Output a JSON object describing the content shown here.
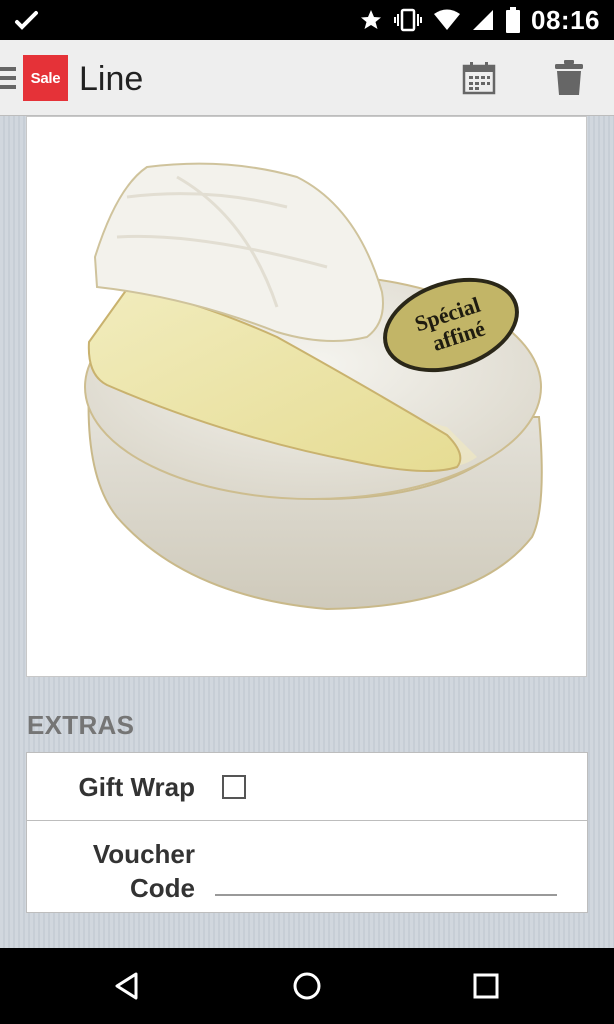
{
  "status_bar": {
    "time": "08:16",
    "icons": [
      "edit-check-icon",
      "star-icon",
      "vibrate-icon",
      "wifi-icon",
      "signal-icon",
      "battery-icon"
    ]
  },
  "app_bar": {
    "logo_text": "Sale",
    "title": "Line",
    "actions": [
      "calendar-icon",
      "trash-icon"
    ]
  },
  "product_image": {
    "subject": "Camembert cheese",
    "label_text_line1": "Spécial",
    "label_text_line2": "affiné"
  },
  "extras": {
    "section_title": "EXTRAS",
    "gift_wrap_label": "Gift Wrap",
    "gift_wrap_checked": false,
    "voucher_label_line1": "Voucher",
    "voucher_label_line2": "Code",
    "voucher_value": ""
  },
  "nav_bar": {
    "buttons": [
      "back-icon",
      "home-icon",
      "recents-icon"
    ]
  },
  "colors": {
    "brand": "#e53238",
    "app_bar": "#eeeeee",
    "background": "#d1d7de"
  }
}
